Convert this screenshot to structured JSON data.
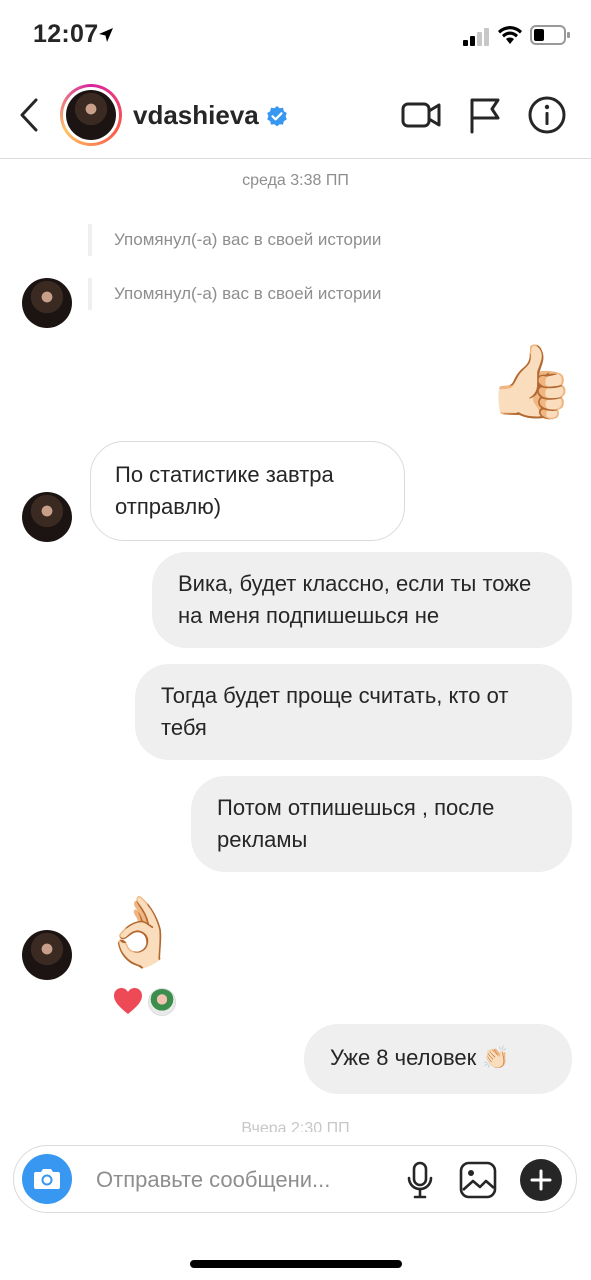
{
  "status_bar": {
    "time": "12:07"
  },
  "header": {
    "username": "vdashieva",
    "verified": true,
    "icons": [
      "back-arrow-icon",
      "video-call-icon",
      "flag-icon",
      "info-icon"
    ]
  },
  "thread": {
    "date_label": "среда 3:38 ПП",
    "mention_1": "Упомянул(-а) вас в своей истории",
    "mention_2": "Упомянул(-а) вас в своей истории",
    "thumbs_up_emoji": "👍🏻",
    "incoming_1": "По статистике завтра отправлю)",
    "outgoing_1": "Вика, будет классно, если ты тоже на меня подпишешься не",
    "outgoing_2": "Тогда будет проще считать, кто от тебя",
    "outgoing_3": "Потом отпишешься , после рекламы",
    "ok_emoji": "👌🏻",
    "reaction_emoji": "❤️",
    "outgoing_4": "Уже 8 человек 👏🏻",
    "faded_date_label": "Вчера 2:30 ПП"
  },
  "composer": {
    "placeholder": "Отправьте сообщени..."
  },
  "colors": {
    "accent": "#3897f0",
    "verified": "#3897f0",
    "bubble_out": "#efefef",
    "text": "#262626",
    "muted": "#8e8e8e",
    "heart": "#ed4956"
  }
}
